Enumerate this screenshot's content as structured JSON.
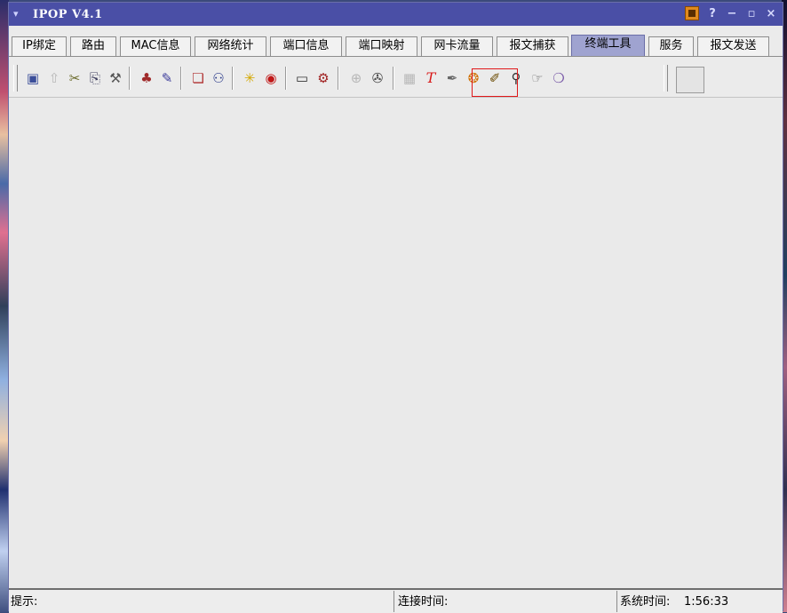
{
  "window": {
    "title": "IPOP V4.1",
    "controls": {
      "help": "?",
      "minimize": "−",
      "restore": "▫",
      "close": "×"
    }
  },
  "tabs": [
    {
      "label": "IP绑定",
      "active": false
    },
    {
      "label": "路由",
      "active": false
    },
    {
      "label": "MAC信息",
      "active": false
    },
    {
      "label": "网络统计",
      "active": false
    },
    {
      "label": "端口信息",
      "active": false
    },
    {
      "label": "端口映射",
      "active": false
    },
    {
      "label": "网卡流量",
      "active": false
    },
    {
      "label": "报文捕获",
      "active": false
    },
    {
      "label": "终端工具",
      "active": true
    },
    {
      "label": "服务",
      "active": false
    },
    {
      "label": "报文发送",
      "active": false
    }
  ],
  "toolbar": {
    "icons": [
      "computer-icon",
      "upload-icon",
      "cut-icon",
      "copy-icon",
      "hammer-icon",
      "users-icon",
      "edit-icon",
      "find-icon",
      "search-user-icon",
      "sun-icon",
      "record-icon",
      "terminal-icon",
      "wrench-icon",
      "zoom-icon",
      "settings-icon",
      "table-icon",
      "text-tool-icon",
      "pen-icon",
      "stamp-icon",
      "pencil-icon",
      "magnify-icon",
      "hand-icon",
      "bubble-icon"
    ]
  },
  "statusbar": {
    "hint_label": "提示:",
    "connect_label": "连接时间:",
    "system_time_label": "系统时间:",
    "system_time_value": "1:56:33"
  },
  "colors": {
    "titlebar": "#4a4fa6",
    "active_tab": "#9fa3d0",
    "highlight": "#e0181a"
  }
}
